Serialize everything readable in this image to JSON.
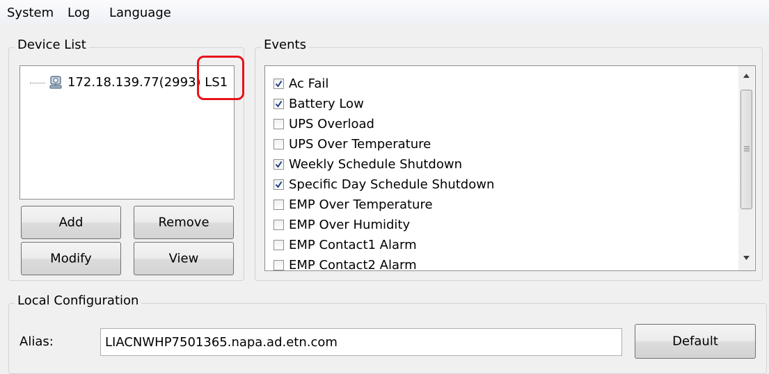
{
  "menu": {
    "items": [
      {
        "label": "System"
      },
      {
        "label": "Log"
      },
      {
        "label": "Language"
      }
    ]
  },
  "device_list": {
    "title": "Device List",
    "devices": [
      {
        "label": "172.18.139.77(2993) LS1",
        "icon": "computer-icon"
      }
    ],
    "buttons": {
      "add": "Add",
      "remove": "Remove",
      "modify": "Modify",
      "view": "View"
    }
  },
  "events": {
    "title": "Events",
    "items": [
      {
        "label": "Ac Fail",
        "checked": true
      },
      {
        "label": "Battery Low",
        "checked": true
      },
      {
        "label": "UPS Overload",
        "checked": false
      },
      {
        "label": "UPS Over Temperature",
        "checked": false
      },
      {
        "label": "Weekly Schedule Shutdown",
        "checked": true
      },
      {
        "label": "Specific Day Schedule Shutdown",
        "checked": true
      },
      {
        "label": "EMP Over Temperature",
        "checked": false
      },
      {
        "label": "EMP Over Humidity",
        "checked": false
      },
      {
        "label": "EMP Contact1 Alarm",
        "checked": false
      },
      {
        "label": "EMP Contact2 Alarm",
        "checked": false
      }
    ]
  },
  "local_config": {
    "title": "Local Configuration",
    "alias_label": "Alias:",
    "alias_value": "LIACNWHP7501365.napa.ad.etn.com",
    "default_button": "Default"
  },
  "colors": {
    "highlight": "#e8121a",
    "check": "#1f3f80"
  }
}
